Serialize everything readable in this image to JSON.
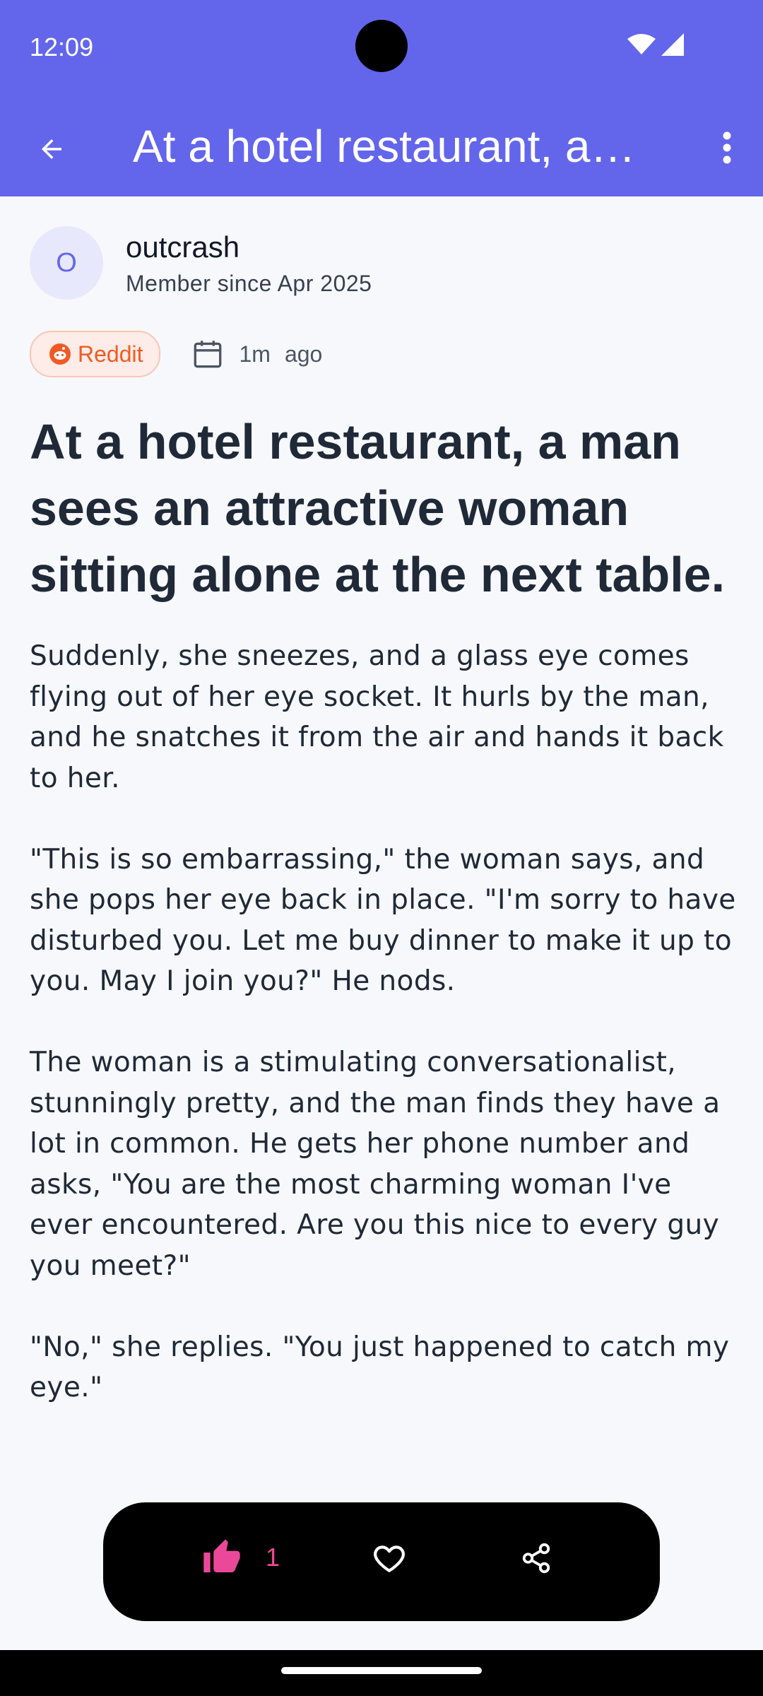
{
  "status_bar": {
    "time": "12:09"
  },
  "app_bar": {
    "title": "At a hotel restaurant, a man sees an attractive woman sitting alone at the next table."
  },
  "author": {
    "initial": "O",
    "name": "outcrash",
    "member_since": "Member since Apr 2025"
  },
  "meta": {
    "source": "Reddit",
    "time_value": "1m",
    "time_suffix": "ago"
  },
  "post": {
    "title": "At a hotel restaurant, a man sees an attractive woman sitting alone at the next table.",
    "paragraphs": [
      "Suddenly, she sneezes, and a glass eye comes flying out of her eye socket. It hurls by the man, and he snatches it from the air and hands it back to her.",
      "\"This is so embarrassing,\" the woman says, and she pops her eye back in place. \"I'm sorry to have disturbed you. Let me buy dinner to make it up to you. May I join you?\" He nods.",
      "The woman is a stimulating conversationalist, stunningly pretty, and the man finds they have a lot in common. He gets her phone number and asks, \"You are the most charming woman I've ever encountered. Are you this nice to every guy you meet?\"",
      "\"No,\" she replies. \"You just happened to catch my eye.\""
    ]
  },
  "actions": {
    "like_count": "1"
  },
  "colors": {
    "primary": "#6366eb",
    "like": "#ec4899",
    "reddit": "#f15a24"
  },
  "icons": [
    "arrow-back-icon",
    "more-vert-icon",
    "reddit-icon",
    "calendar-icon",
    "thumb-up-icon",
    "heart-icon",
    "share-icon",
    "wifi-icon",
    "signal-icon"
  ]
}
